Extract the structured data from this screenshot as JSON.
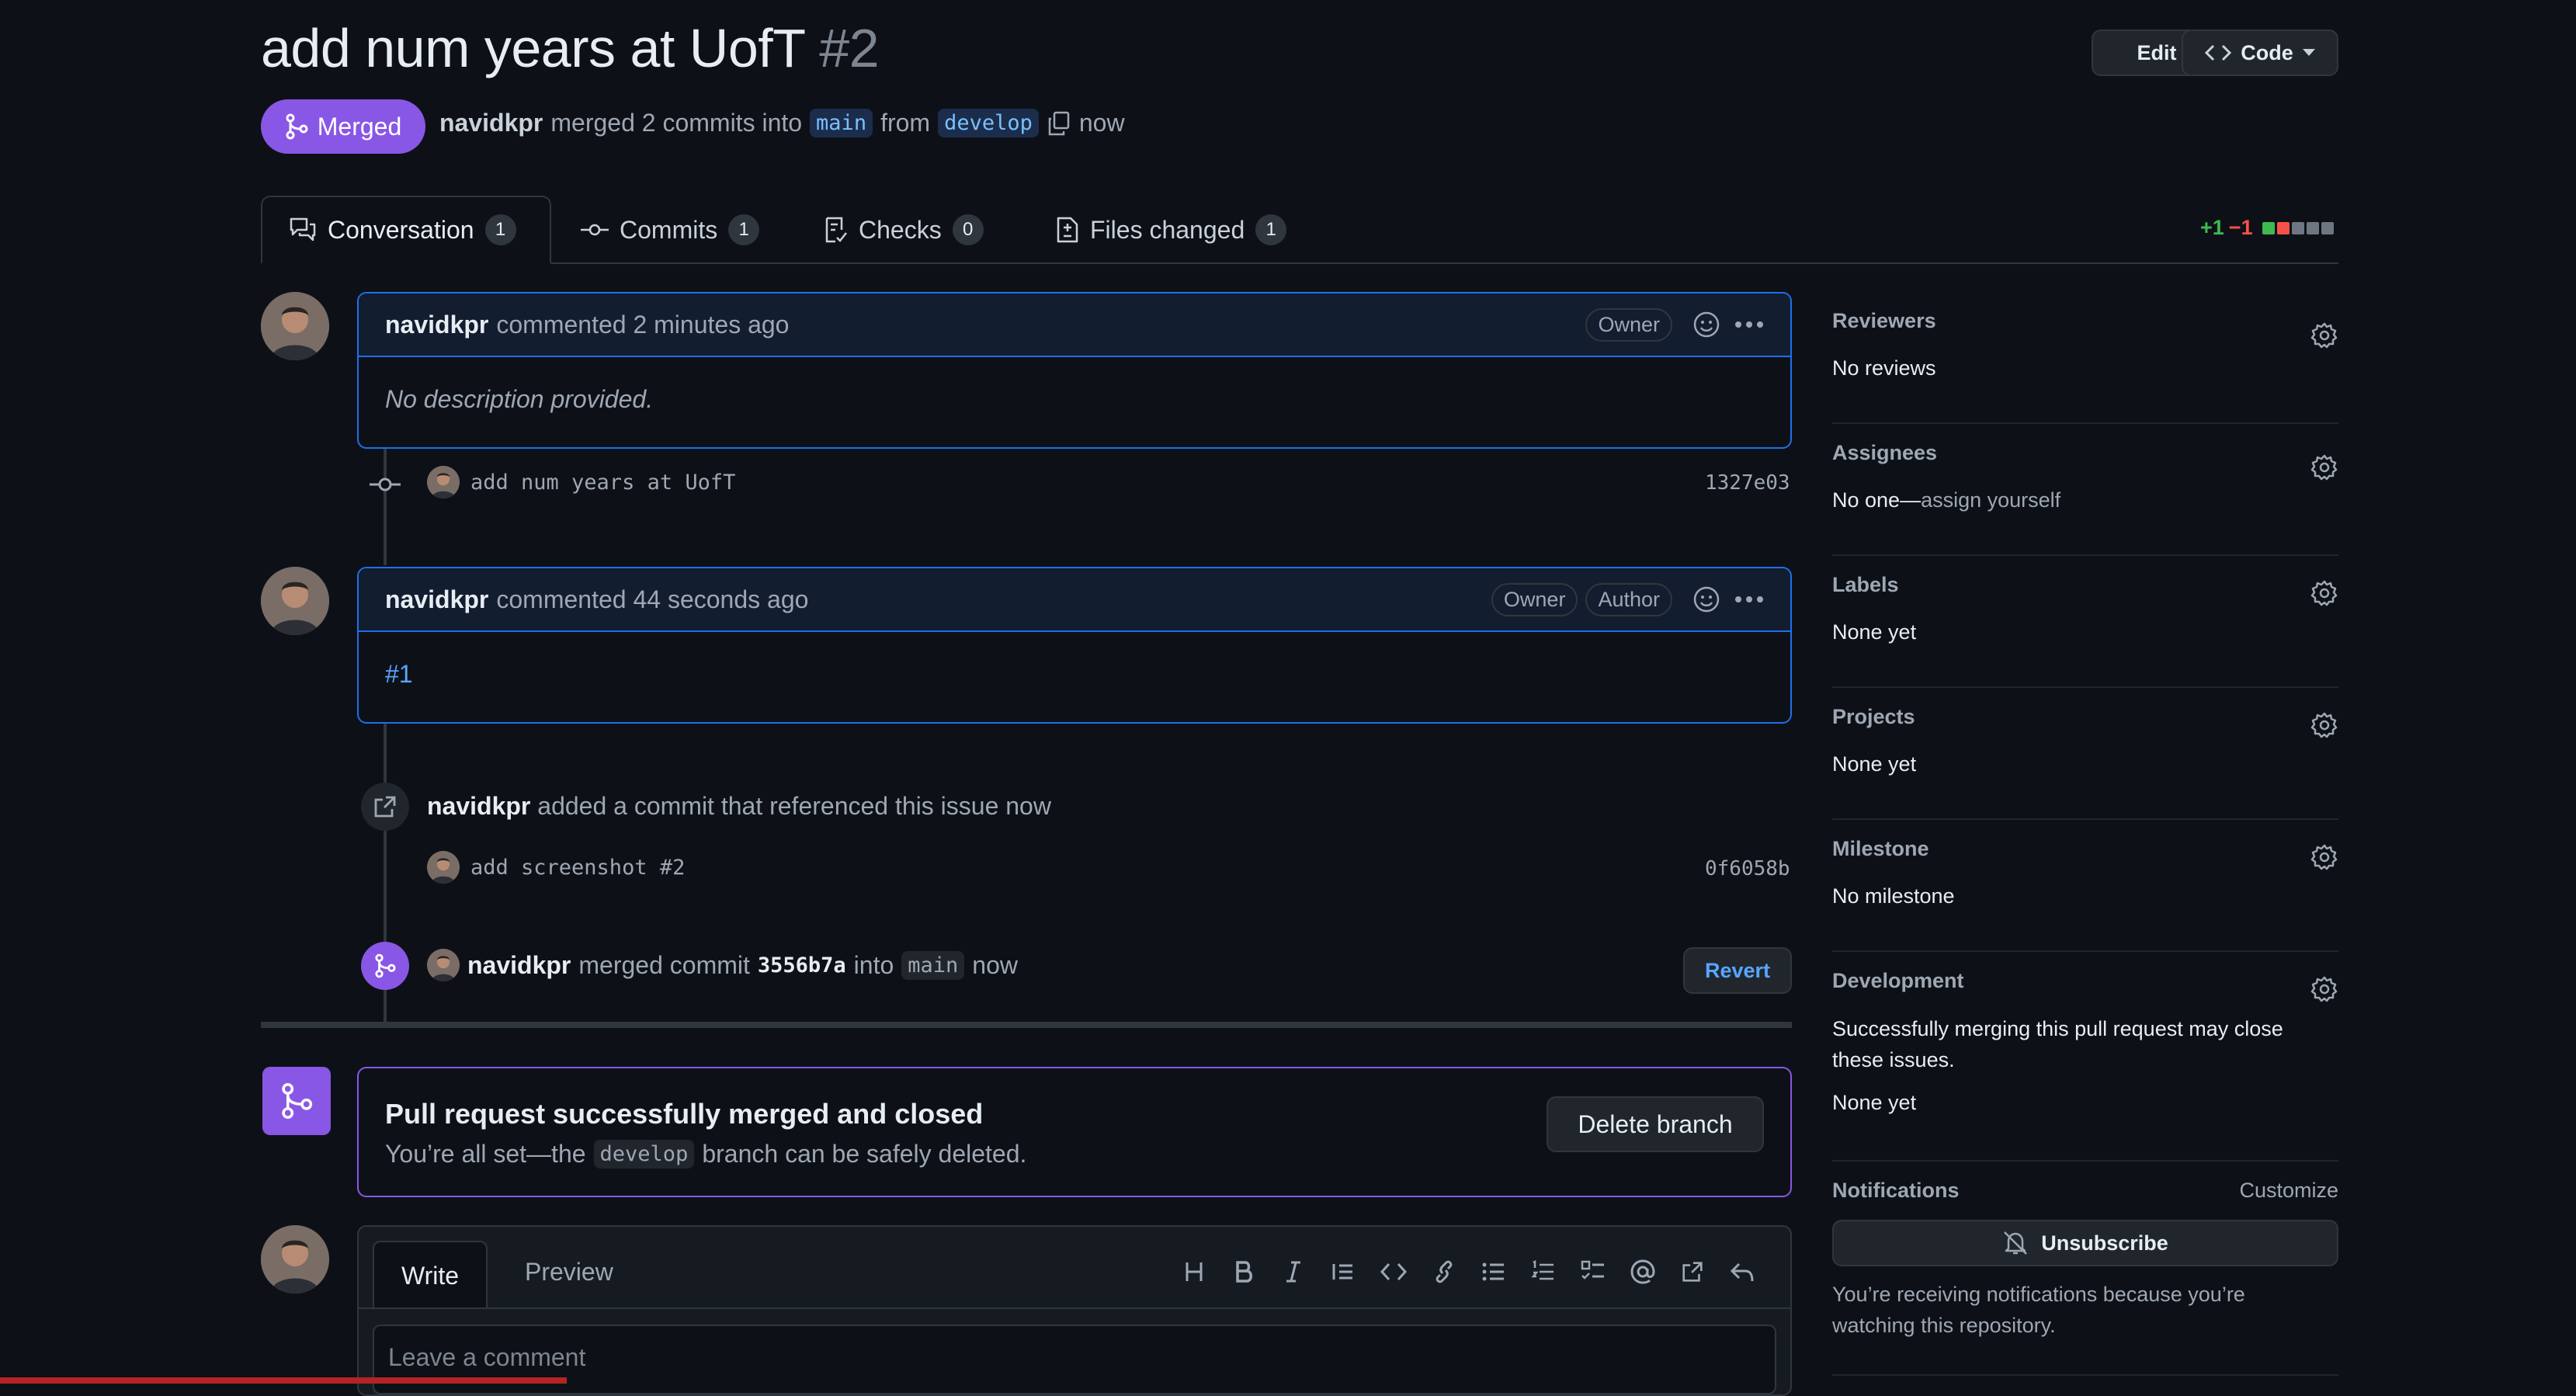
{
  "pr": {
    "title": "add num years at UofT",
    "number": "#2",
    "state": "Merged",
    "author": "navidkpr",
    "merge_text": "merged 2 commits into",
    "base_branch": "main",
    "from_text": "from",
    "head_branch": "develop",
    "time": "now"
  },
  "header_buttons": {
    "edit": "Edit",
    "code": "Code"
  },
  "tabs": [
    {
      "label": "Conversation",
      "count": "1",
      "icon": "comment-discussion-icon"
    },
    {
      "label": "Commits",
      "count": "1",
      "icon": "git-commit-icon"
    },
    {
      "label": "Checks",
      "count": "0",
      "icon": "checklist-icon"
    },
    {
      "label": "Files changed",
      "count": "1",
      "icon": "file-diff-icon"
    }
  ],
  "diffstat": {
    "additions": "+1",
    "deletions": "−1"
  },
  "timeline": {
    "comment1": {
      "author": "navidkpr",
      "action": "commented 2 minutes ago",
      "badge": "Owner",
      "body": "No description provided."
    },
    "commit1": {
      "message": "add num years at UofT",
      "sha": "1327e03"
    },
    "comment2": {
      "author": "navidkpr",
      "action": "commented 44 seconds ago",
      "badges": [
        "Owner",
        "Author"
      ],
      "body": "#1"
    },
    "ref_event": {
      "author": "navidkpr",
      "text": "added a commit that referenced this issue now"
    },
    "commit2": {
      "message": "add screenshot #2",
      "sha": "0f6058b"
    },
    "merge_event": {
      "author": "navidkpr",
      "text1": "merged commit",
      "sha": "3556b7a",
      "text2": "into",
      "branch": "main",
      "time": "now",
      "revert": "Revert"
    }
  },
  "merged_box": {
    "title": "Pull request successfully merged and closed",
    "text_before": "You’re all set—the",
    "branch": "develop",
    "text_after": "branch can be safely deleted.",
    "button": "Delete branch"
  },
  "editor": {
    "write": "Write",
    "preview": "Preview",
    "placeholder": "Leave a comment"
  },
  "sidebar": {
    "reviewers": {
      "title": "Reviewers",
      "value": "No reviews"
    },
    "assignees": {
      "title": "Assignees",
      "value": "No one—",
      "link": "assign yourself"
    },
    "labels": {
      "title": "Labels",
      "value": "None yet"
    },
    "projects": {
      "title": "Projects",
      "value": "None yet"
    },
    "milestone": {
      "title": "Milestone",
      "value": "No milestone"
    },
    "development": {
      "title": "Development",
      "desc": "Successfully merging this pull request may close these issues.",
      "value": "None yet"
    },
    "notifications": {
      "title": "Notifications",
      "customize": "Customize",
      "button": "Unsubscribe",
      "desc": "You’re receiving notifications because you’re watching this repository."
    }
  },
  "colors": {
    "merged": "#8957e5",
    "accent": "#1f6feb",
    "link": "#58a6ff",
    "bg": "#0d1117"
  }
}
